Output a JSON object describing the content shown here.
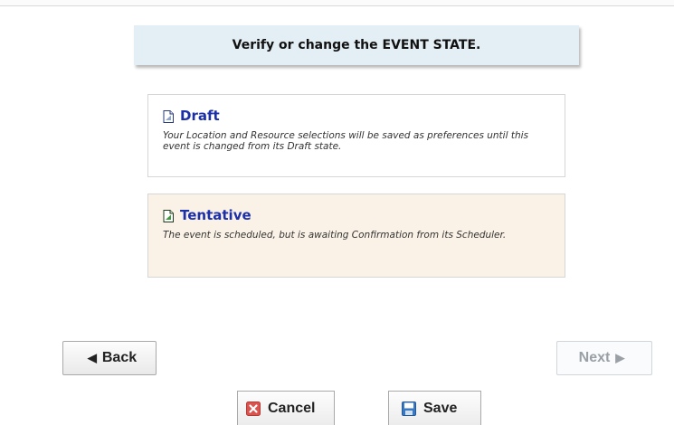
{
  "banner": {
    "text": "Verify or change the EVENT STATE."
  },
  "states": [
    {
      "title": "Draft",
      "description": "Your Location and Resource selections will be saved as preferences until this event is changed from its Draft state.",
      "selected": false,
      "icon": "document-icon"
    },
    {
      "title": "Tentative",
      "description": "The event is scheduled, but is awaiting Confirmation from its Scheduler.",
      "selected": true,
      "icon": "document-green-icon"
    }
  ],
  "nav": {
    "back_label": "Back",
    "next_label": "Next",
    "next_disabled": true
  },
  "actions": {
    "cancel_label": "Cancel",
    "save_label": "Save"
  },
  "colors": {
    "title_blue": "#1b2fa8",
    "selected_bg": "#fbf2e7",
    "banner_bg": "#e4eef5",
    "cancel_red": "#d9534f",
    "save_blue": "#3b78c2"
  }
}
